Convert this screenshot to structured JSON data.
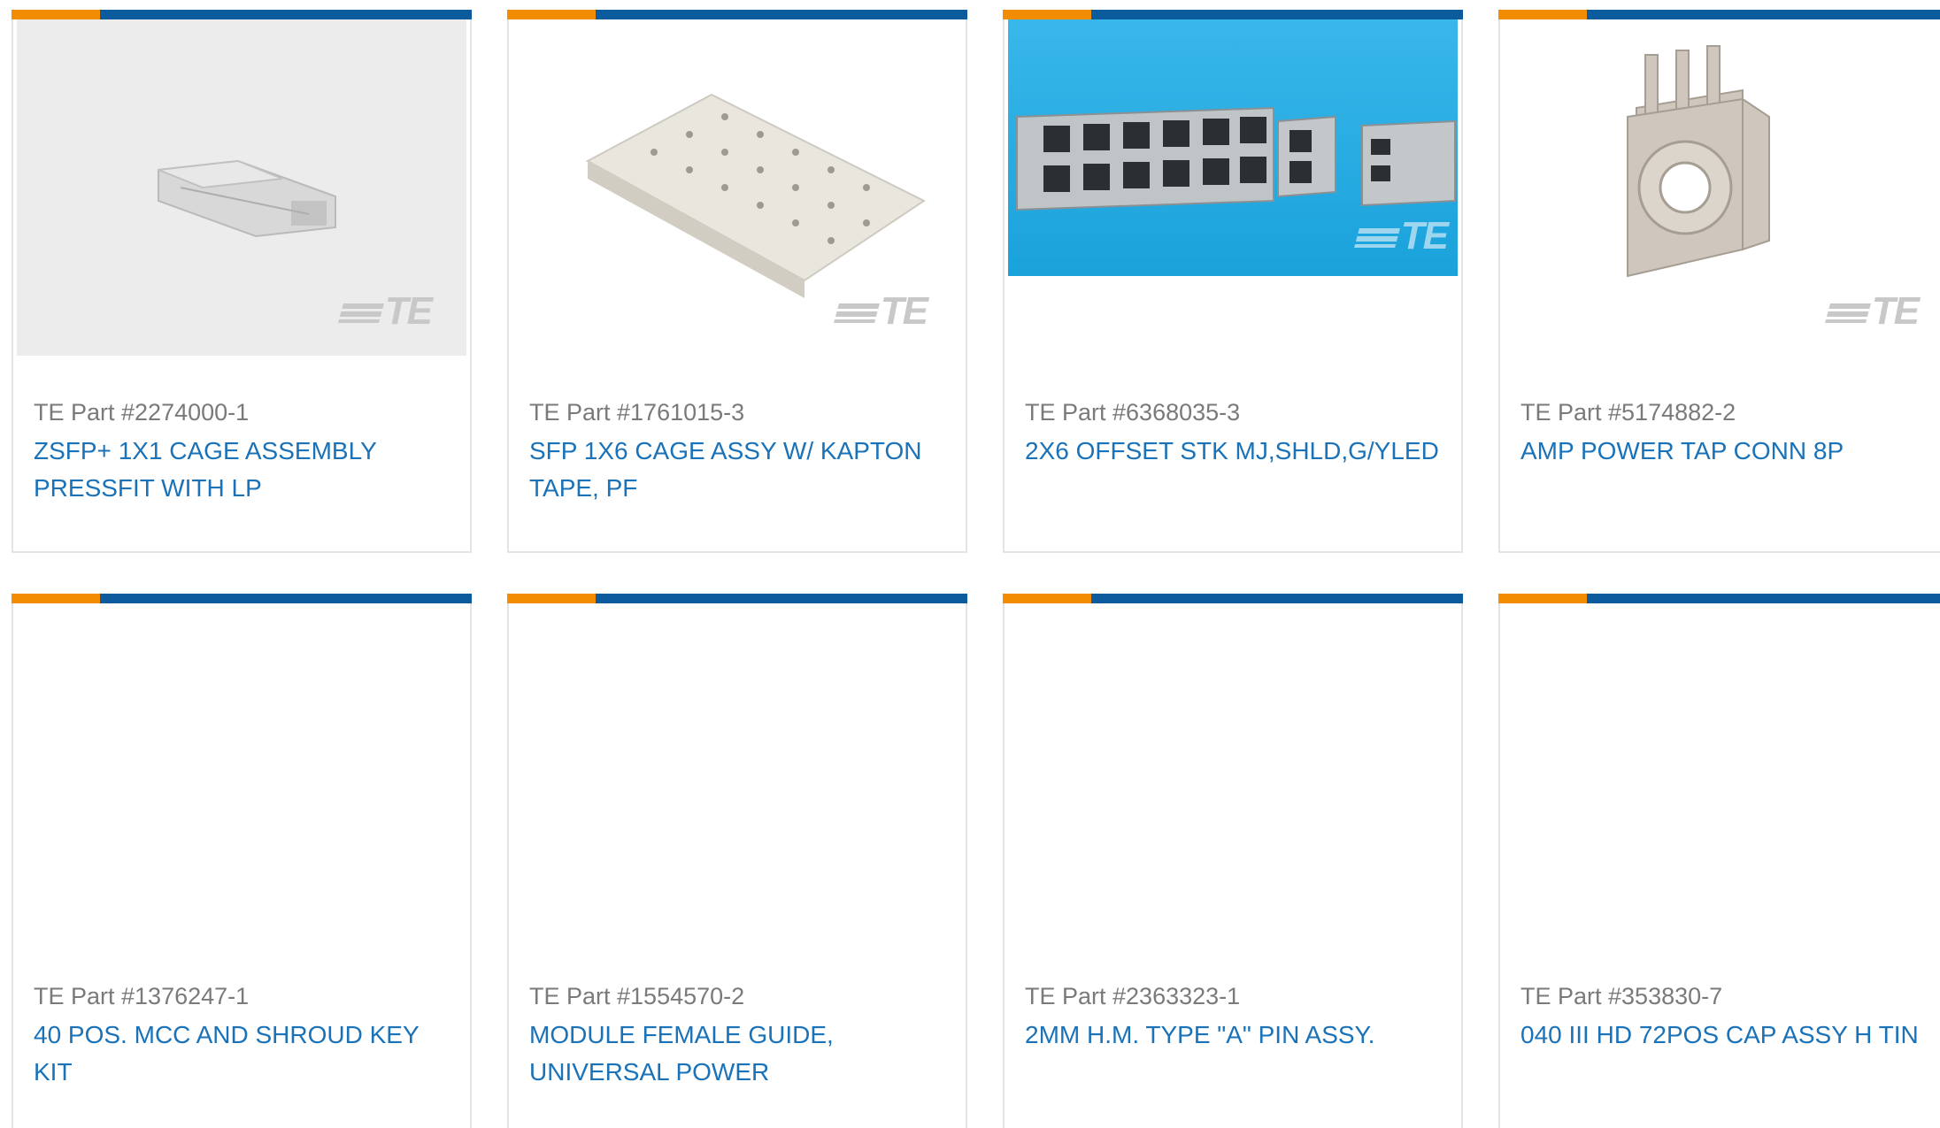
{
  "products": [
    {
      "part_label": "TE Part #2274000-1",
      "title": "ZSFP+ 1X1 CAGE ASSEMBLY PRESSFIT WITH LP",
      "image": "zsfp-cage-image",
      "watermark": "TE"
    },
    {
      "part_label": "TE Part #1761015-3",
      "title": "SFP 1X6 CAGE ASSY W/ KAPTON TAPE, PF",
      "image": "sfp-1x6-cage-image",
      "watermark": "TE"
    },
    {
      "part_label": "TE Part #6368035-3",
      "title": "2X6 OFFSET STK MJ,SHLD,G/YLED",
      "image": "offset-stack-modular-jack-image",
      "watermark": "TE"
    },
    {
      "part_label": "TE Part #5174882-2",
      "title": "AMP POWER TAP CONN 8P",
      "image": "power-tap-connector-image",
      "watermark": "TE"
    },
    {
      "part_label": "TE Part #1376247-1",
      "title": "40 POS. MCC AND SHROUD KEY KIT",
      "image": "",
      "watermark": ""
    },
    {
      "part_label": "TE Part #1554570-2",
      "title": "MODULE FEMALE GUIDE, UNIVERSAL POWER",
      "image": "",
      "watermark": ""
    },
    {
      "part_label": "TE Part #2363323-1",
      "title": "2MM H.M. TYPE \"A\" PIN ASSY.",
      "image": "",
      "watermark": ""
    },
    {
      "part_label": "TE Part #353830-7",
      "title": "040 III HD 72POS CAP ASSY H TIN",
      "image": "",
      "watermark": ""
    }
  ],
  "colors": {
    "accent_orange": "#f28c00",
    "accent_blue": "#0c5b9c",
    "title_blue": "#1a72b8",
    "part_grey": "#7a7a7a",
    "photo_cyan": "#1aa2db"
  }
}
